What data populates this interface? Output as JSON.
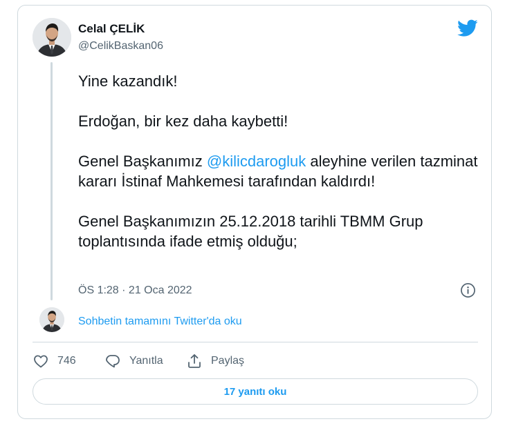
{
  "author": {
    "name": "Celal ÇELİK",
    "handle": "@CelikBaskan06"
  },
  "tweet": {
    "line1": "Yine kazandık!",
    "line2": "Erdoğan, bir kez daha kaybetti!",
    "line3_before": "Genel Başkanımız ",
    "line3_mention": "@kilicdarogluk",
    "line3_after": " aleyhine verilen tazminat kararı İstinaf Mahkemesi tarafından kaldırdı!",
    "line4": "Genel Başkanımızın 25.12.2018 tarihli TBMM Grup toplantısında ifade etmiş olduğu;"
  },
  "timestamp": "ÖS 1:28 · 21 Oca 2022",
  "thread_link": "Sohbetin tamamını Twitter'da oku",
  "actions": {
    "like_count": "746",
    "reply_label": "Yanıtla",
    "share_label": "Paylaş"
  },
  "read_replies": "17 yanıtı oku",
  "icons": {
    "brand": "twitter-bird-icon",
    "info": "info-icon",
    "like": "heart-icon",
    "reply": "reply-bubble-icon",
    "share": "share-icon"
  },
  "colors": {
    "accent": "#1d9bf0",
    "text": "#0f1419",
    "secondary": "#536471",
    "border": "#cfd9de"
  }
}
